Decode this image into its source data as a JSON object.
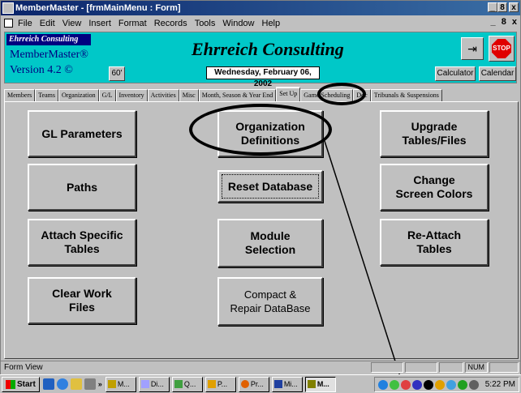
{
  "window": {
    "title": "MemberMaster - [frmMainMenu : Form]",
    "controls": [
      "_",
      "8",
      "x"
    ]
  },
  "menubar": {
    "items": [
      "File",
      "Edit",
      "View",
      "Insert",
      "Format",
      "Records",
      "Tools",
      "Window",
      "Help"
    ],
    "doc_controls": "_ 8 x"
  },
  "header": {
    "brand_top": "Ehrreich Consulting",
    "brand_name": "MemberMaster®",
    "brand_version": "Version 4.2 ©",
    "company": "Ehrreich Consulting",
    "date": "Wednesday, February 06, 2002",
    "sixty_label": "60'",
    "exit_label": "⇥",
    "stop_label": "STOP",
    "calculator_label": "Calculator",
    "calendar_label": "Calendar"
  },
  "tabs": [
    "Members",
    "Teams",
    "Organization",
    "G/L",
    "Inventory",
    "Activities",
    "Misc",
    "Month, Season & Year End",
    "Set Up",
    "Game Scheduling",
    "Doc",
    "Tribunals & Suspensions"
  ],
  "active_tab": "Set Up",
  "buttons": {
    "gl_parameters": "GL Parameters",
    "org_definitions_1": "Organization",
    "org_definitions_2": "Definitions",
    "upgrade_1": "Upgrade",
    "upgrade_2": "Tables/Files",
    "paths": "Paths",
    "reset_database": "Reset Database",
    "colors_1": "Change",
    "colors_2": "Screen Colors",
    "attach_1": "Attach Specific",
    "attach_2": "Tables",
    "module_1": "Module",
    "module_2": "Selection",
    "reattach_1": "Re-Attach",
    "reattach_2": "Tables",
    "clear_1": "Clear Work",
    "clear_2": "Files",
    "compact_1": "Compact &",
    "compact_2": "Repair DataBase"
  },
  "status": {
    "text": "Form View",
    "num": "NUM"
  },
  "taskbar": {
    "start": "Start",
    "tasks": [
      "M...",
      "Di...",
      "Q...",
      "P...",
      "Pr...",
      "Mi...",
      "M..."
    ],
    "clock": "5:22 PM"
  }
}
